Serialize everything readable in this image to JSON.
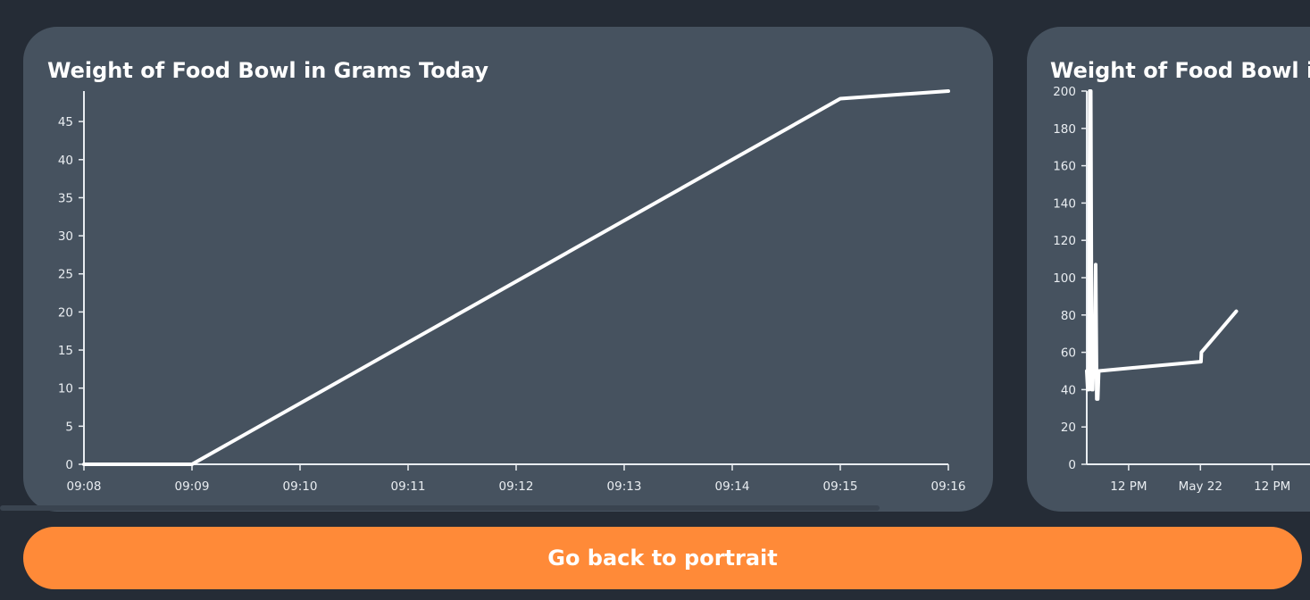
{
  "cards": [
    {
      "title": "Weight of Food Bowl in Grams Today"
    },
    {
      "title": "Weight of Food Bowl in Grams"
    }
  ],
  "chart_data": [
    {
      "type": "line",
      "title": "Weight of Food Bowl in Grams Today",
      "xlabel": "",
      "ylabel": "",
      "x_ticks": [
        "09:08",
        "09:09",
        "09:10",
        "09:11",
        "09:12",
        "09:13",
        "09:14",
        "09:15",
        "09:16"
      ],
      "y_ticks": [
        0,
        5,
        10,
        15,
        20,
        25,
        30,
        35,
        40,
        45
      ],
      "ylim": [
        0,
        49
      ],
      "xlim": [
        "09:08",
        "09:16"
      ],
      "grid": false,
      "series": [
        {
          "x": [
            "09:08",
            "09:09",
            "09:15",
            "09:16"
          ],
          "y": [
            0,
            0,
            48,
            49
          ]
        }
      ],
      "line_color": "#ffffff"
    },
    {
      "type": "line",
      "title": "Weight of Food Bowl in Grams",
      "xlabel": "",
      "ylabel": "",
      "x_ticks": [
        "12 PM",
        "May 22",
        "12 PM"
      ],
      "y_ticks": [
        0,
        20,
        40,
        60,
        80,
        100,
        120,
        140,
        160,
        180,
        200
      ],
      "ylim": [
        0,
        200
      ],
      "grid": false,
      "series": [
        {
          "x": [
            "May 21 05:00",
            "May 21 05:10",
            "May 21 05:20",
            "May 21 05:30",
            "May 21 05:40",
            "May 21 05:50",
            "May 21 06:00",
            "May 21 06:10",
            "May 21 06:20",
            "May 21 06:30",
            "May 21 06:40",
            "May 21 06:50",
            "May 21 07:00",
            "May 22 00:00",
            "May 22 00:05",
            "May 22 00:10",
            "May 22 06:00"
          ],
          "y": [
            50,
            40,
            40,
            200,
            200,
            40,
            40,
            63,
            63,
            107,
            35,
            35,
            50,
            55,
            55,
            60,
            82
          ]
        }
      ],
      "line_color": "#ffffff"
    }
  ],
  "button": {
    "label": "Go back to portrait"
  },
  "colors": {
    "background": "#252c36",
    "card": "#46525f",
    "accent": "#ff8a38",
    "text": "#ffffff"
  }
}
